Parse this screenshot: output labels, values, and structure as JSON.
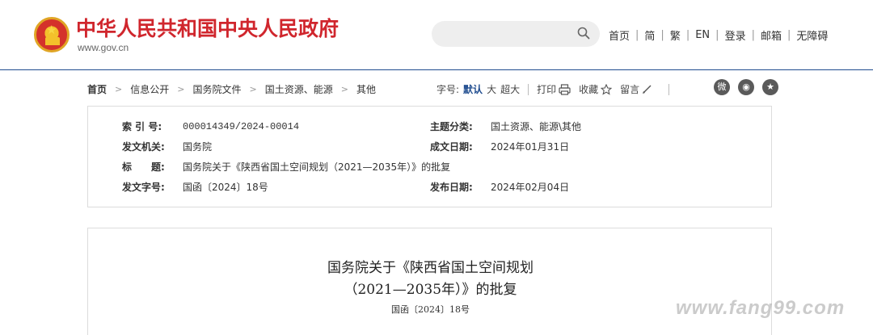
{
  "header": {
    "site_title": "中华人民共和国中央人民政府",
    "site_url": "www.gov.cn",
    "search_placeholder": "",
    "links": [
      "首页",
      "简",
      "繁",
      "EN",
      "登录",
      "邮箱",
      "无障碍"
    ]
  },
  "breadcrumb": {
    "items": [
      "首页",
      "信息公开",
      "国务院文件",
      "国土资源、能源",
      "其他"
    ]
  },
  "tools": {
    "font_label": "字号:",
    "font_sizes": [
      "默认",
      "大",
      "超大"
    ],
    "print_label": "打印",
    "favorite_label": "收藏",
    "comment_label": "留言"
  },
  "meta": {
    "index_key": "索 引 号:",
    "index_value": "000014349/2024-00014",
    "topic_key": "主题分类:",
    "topic_value": "国土资源、能源\\其他",
    "issuer_key": "发文机关:",
    "issuer_value": "国务院",
    "date_key": "成文日期:",
    "date_value": "2024年01月31日",
    "title_key": "标　　题:",
    "title_value": "国务院关于《陕西省国土空间规划（2021—2035年）》的批复",
    "docno_key": "发文字号:",
    "docno_value": "国函〔2024〕18号",
    "pubdate_key": "发布日期:",
    "pubdate_value": "2024年02月04日"
  },
  "article": {
    "title_line1": "国务院关于《陕西省国土空间规划",
    "title_line2": "（2021—2035年）》的批复",
    "doc_number": "国函〔2024〕18号"
  },
  "watermark": "www.fang99.com",
  "colors": {
    "brand_red": "#d0262d",
    "accent_blue": "#1f4c8f"
  }
}
